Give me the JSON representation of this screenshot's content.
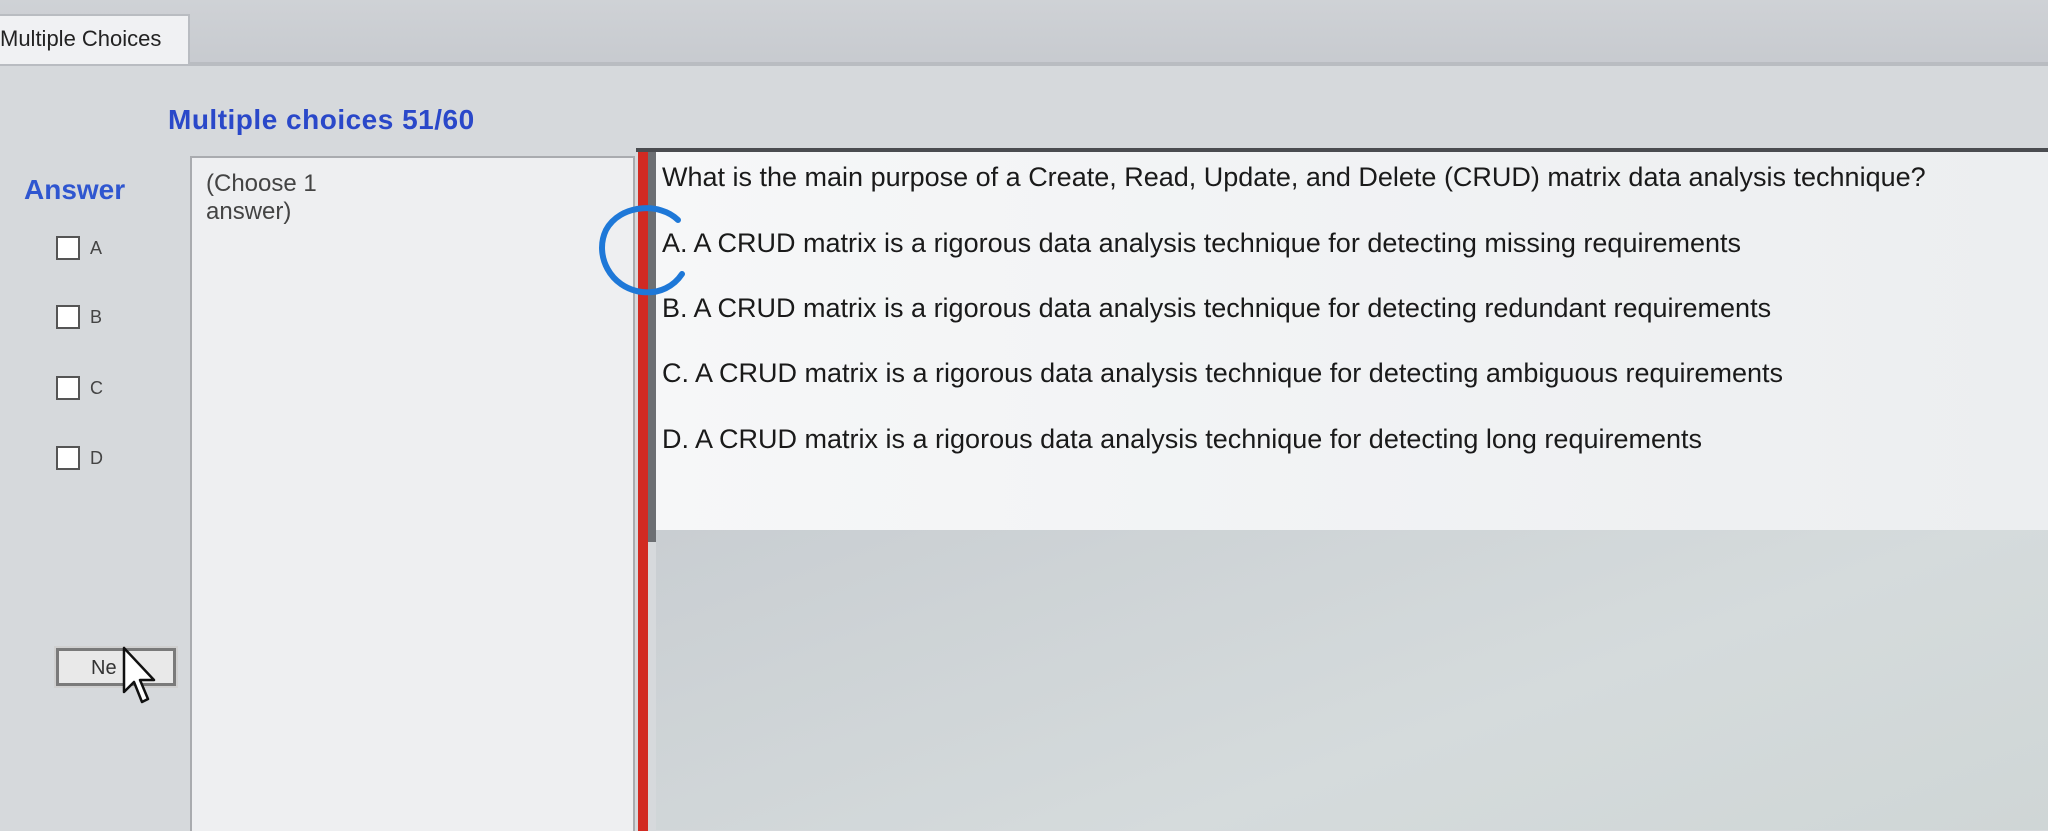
{
  "tab": {
    "label": "Multiple Choices"
  },
  "header": {
    "title": "Multiple choices 51/60"
  },
  "answer_panel": {
    "label": "Answer",
    "options": [
      {
        "letter": "A"
      },
      {
        "letter": "B"
      },
      {
        "letter": "C"
      },
      {
        "letter": "D"
      }
    ],
    "next_button": "Ne"
  },
  "instructions": {
    "text": "(Choose 1 answer)"
  },
  "question": {
    "text": "What is the main purpose of a Create, Read, Update, and Delete (CRUD) matrix data analysis technique?",
    "choices": [
      {
        "prefix": "A.",
        "text": "A CRUD matrix is a rigorous data analysis technique for detecting missing requirements"
      },
      {
        "prefix": "B.",
        "text": "A CRUD matrix is a rigorous data analysis technique for detecting redundant requirements"
      },
      {
        "prefix": "C.",
        "text": "A CRUD matrix is a rigorous data analysis technique for detecting ambiguous requirements"
      },
      {
        "prefix": "D.",
        "text": "A CRUD matrix is a rigorous data analysis technique for detecting long requirements"
      }
    ]
  },
  "colors": {
    "title": "#2a48c9",
    "accent_bar": "#d22a22",
    "annotation": "#1e78d8"
  },
  "icons": {
    "cursor": "mouse-pointer-icon",
    "annotation": "hand-drawn-circle-annotation"
  }
}
